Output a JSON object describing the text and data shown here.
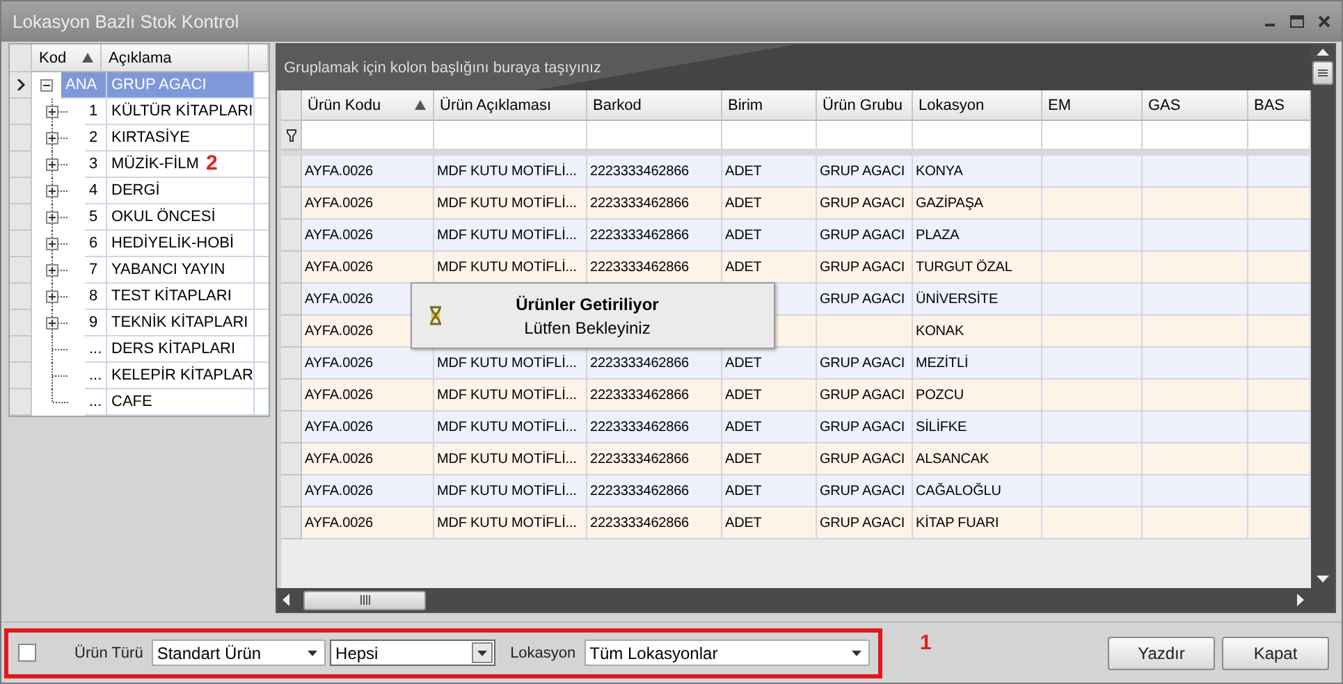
{
  "window": {
    "title": "Lokasyon Bazlı Stok Kontrol"
  },
  "tree": {
    "columns": [
      {
        "label": "Kod",
        "sorted": true
      },
      {
        "label": "Açıklama",
        "sorted": false
      }
    ],
    "callout": "2",
    "root": {
      "code": "ANA",
      "label": "GRUP AGACI",
      "selected": true,
      "expanded": true,
      "children": [
        {
          "code": "1",
          "label": "KÜLTÜR KİTAPLARI",
          "expandable": true,
          "selected": false
        },
        {
          "code": "2",
          "label": "KIRTASİYE",
          "expandable": true,
          "selected": false
        },
        {
          "code": "3",
          "label": "MÜZİK-FİLM",
          "expandable": true,
          "selected": false
        },
        {
          "code": "4",
          "label": "DERGİ",
          "expandable": true,
          "selected": false
        },
        {
          "code": "5",
          "label": "OKUL ÖNCESİ",
          "expandable": true,
          "selected": false
        },
        {
          "code": "6",
          "label": "HEDİYELİK-HOBİ",
          "expandable": true,
          "selected": false
        },
        {
          "code": "7",
          "label": "YABANCI YAYIN",
          "expandable": true,
          "selected": false
        },
        {
          "code": "8",
          "label": "TEST KİTAPLARI",
          "expandable": true,
          "selected": false
        },
        {
          "code": "9",
          "label": "TEKNİK KİTAPLARI",
          "expandable": true,
          "selected": false
        },
        {
          "code": "...",
          "label": "DERS KİTAPLARI",
          "expandable": false,
          "selected": false
        },
        {
          "code": "...",
          "label": "KELEPİR KİTAPLAR",
          "expandable": false,
          "selected": false
        },
        {
          "code": "...",
          "label": "CAFE",
          "expandable": false,
          "selected": false
        }
      ]
    }
  },
  "grid": {
    "group_hint": "Gruplamak için kolon başlığını buraya taşıyınız",
    "columns": [
      {
        "label": "Ürün Kodu",
        "sorted": true
      },
      {
        "label": "Ürün Açıklaması",
        "sorted": false
      },
      {
        "label": "Barkod",
        "sorted": false
      },
      {
        "label": "Birim",
        "sorted": false
      },
      {
        "label": "Ürün Grubu",
        "sorted": false
      },
      {
        "label": "Lokasyon",
        "sorted": false
      },
      {
        "label": "EM",
        "sorted": false
      },
      {
        "label": "GAS",
        "sorted": false
      },
      {
        "label": "BAS",
        "sorted": false
      }
    ],
    "rows": [
      {
        "code": "AYFA.0026",
        "description": "MDF KUTU MOTİFLİ...",
        "barcode": "2223333462866",
        "unit": "ADET",
        "group": "GRUP AGACI",
        "location": "KONYA"
      },
      {
        "code": "AYFA.0026",
        "description": "MDF KUTU MOTİFLİ...",
        "barcode": "2223333462866",
        "unit": "ADET",
        "group": "GRUP AGACI",
        "location": "GAZİPAŞA"
      },
      {
        "code": "AYFA.0026",
        "description": "MDF KUTU MOTİFLİ...",
        "barcode": "2223333462866",
        "unit": "ADET",
        "group": "GRUP AGACI",
        "location": "PLAZA"
      },
      {
        "code": "AYFA.0026",
        "description": "MDF KUTU MOTİFLİ...",
        "barcode": "2223333462866",
        "unit": "ADET",
        "group": "GRUP AGACI",
        "location": "TURGUT ÖZAL"
      },
      {
        "code": "AYFA.0026",
        "group": "GRUP AGACI",
        "location": "ÜNİVERSİTE"
      },
      {
        "code": "AYFA.0026",
        "location": "KONAK"
      },
      {
        "code": "AYFA.0026",
        "description": "MDF KUTU MOTİFLİ...",
        "barcode": "2223333462866",
        "unit": "ADET",
        "group": "GRUP AGACI",
        "location": "MEZİTLİ"
      },
      {
        "code": "AYFA.0026",
        "description": "MDF KUTU MOTİFLİ...",
        "barcode": "2223333462866",
        "unit": "ADET",
        "group": "GRUP AGACI",
        "location": "POZCU"
      },
      {
        "code": "AYFA.0026",
        "description": "MDF KUTU MOTİFLİ...",
        "barcode": "2223333462866",
        "unit": "ADET",
        "group": "GRUP AGACI",
        "location": "SİLİFKE"
      },
      {
        "code": "AYFA.0026",
        "description": "MDF KUTU MOTİFLİ...",
        "barcode": "2223333462866",
        "unit": "ADET",
        "group": "GRUP AGACI",
        "location": "ALSANCAK"
      },
      {
        "code": "AYFA.0026",
        "description": "MDF KUTU MOTİFLİ...",
        "barcode": "2223333462866",
        "unit": "ADET",
        "group": "GRUP AGACI",
        "location": "CAĞALOĞLU"
      },
      {
        "code": "AYFA.0026",
        "description": "MDF KUTU MOTİFLİ...",
        "barcode": "2223333462866",
        "unit": "ADET",
        "group": "GRUP AGACI",
        "location": "KİTAP FUARI"
      }
    ],
    "loading": {
      "title": "Ürünler Getiriliyor",
      "message": "Lütfen Bekleyiniz"
    }
  },
  "filters": {
    "highlighted": true,
    "callout": "1",
    "checkbox": {
      "checked": false
    },
    "product_type_label": "Ürün Türü",
    "combos": [
      {
        "kind": "flat",
        "value": "Standart Ürün"
      },
      {
        "kind": "button",
        "value": "Hepsi"
      }
    ],
    "location_label": "Lokasyon",
    "location": {
      "value": "Tüm Lokasyonlar"
    }
  },
  "buttons": [
    "Yazdır",
    "Kapat"
  ]
}
